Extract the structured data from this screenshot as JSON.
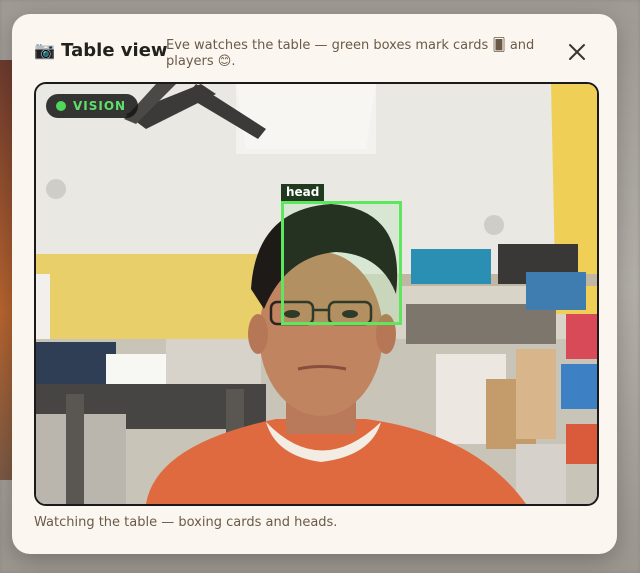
{
  "modal": {
    "title_icon": "📷",
    "title": "Table view",
    "subtitle": "Eve watches the table — green boxes mark cards 🂠 and players 😊.",
    "close_icon": "close-icon"
  },
  "video": {
    "badge": "VISION",
    "detections": [
      {
        "label": "head"
      }
    ]
  },
  "footer": {
    "status": "Watching the table — boxing cards and heads."
  },
  "colors": {
    "accent_green": "#5ee65f",
    "panel_bg": "#fbf7f0",
    "muted_text": "#6b5a48"
  }
}
